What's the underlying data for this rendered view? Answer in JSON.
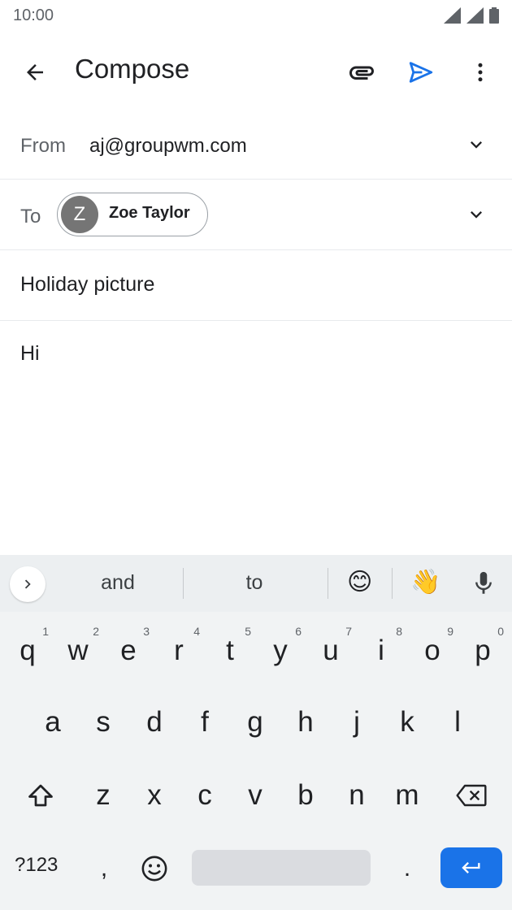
{
  "status_bar": {
    "time": "10:00"
  },
  "app_bar": {
    "title": "Compose"
  },
  "from": {
    "label": "From",
    "value": "aj@groupwm.com"
  },
  "to": {
    "label": "To",
    "chip_initial": "Z",
    "chip_name": "Zoe Taylor"
  },
  "subject": {
    "value": "Holiday picture"
  },
  "body": {
    "value": "Hi"
  },
  "keyboard": {
    "suggestions": [
      "and",
      "to"
    ],
    "emoji_suggestions": [
      "😊",
      "👋"
    ],
    "row1": [
      {
        "key": "q",
        "num": "1"
      },
      {
        "key": "w",
        "num": "2"
      },
      {
        "key": "e",
        "num": "3"
      },
      {
        "key": "r",
        "num": "4"
      },
      {
        "key": "t",
        "num": "5"
      },
      {
        "key": "y",
        "num": "6"
      },
      {
        "key": "u",
        "num": "7"
      },
      {
        "key": "i",
        "num": "8"
      },
      {
        "key": "o",
        "num": "9"
      },
      {
        "key": "p",
        "num": "0"
      }
    ],
    "row2": [
      "a",
      "s",
      "d",
      "f",
      "g",
      "h",
      "j",
      "k",
      "l"
    ],
    "row3": [
      "z",
      "x",
      "c",
      "v",
      "b",
      "n",
      "m"
    ],
    "symbols_label": "?123",
    "comma": ",",
    "period": "."
  },
  "colors": {
    "accent": "#1a73e8",
    "text_primary": "#202124",
    "text_secondary": "#5f6368",
    "chip_avatar": "#757575"
  },
  "icons": {
    "back": "arrow-left-icon",
    "attach": "paperclip-icon",
    "send": "send-icon",
    "more": "more-vert-icon",
    "expand": "chevron-down-icon",
    "mic": "mic-icon",
    "shift": "shift-icon",
    "backspace": "backspace-icon",
    "emoji": "smiley-icon",
    "enter": "enter-icon"
  }
}
